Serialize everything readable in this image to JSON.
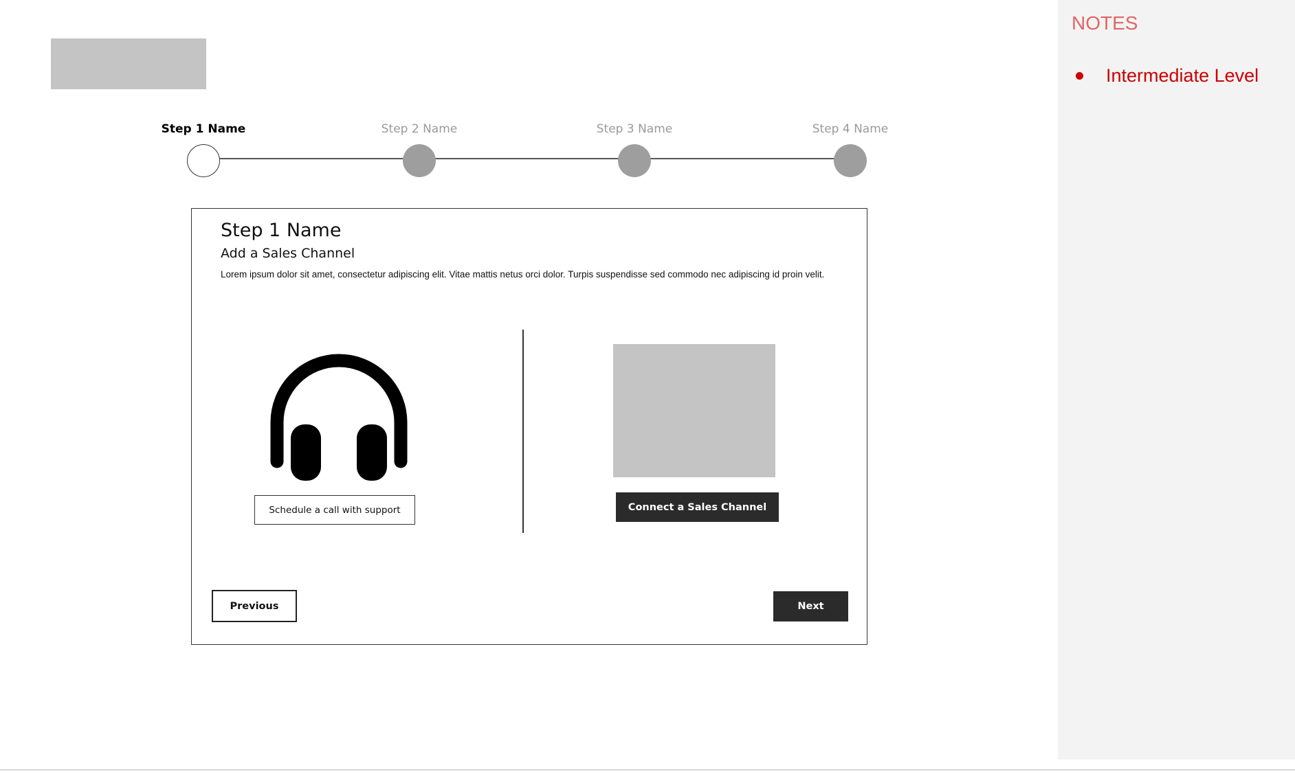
{
  "colors": {
    "notes_heading": "#e06666",
    "notes_text": "#cc0000",
    "placeholder_gray": "#c4c4c4",
    "inactive_step": "#9e9e9e",
    "dark_button": "#2b2b2b"
  },
  "stepper": {
    "current_step": 1,
    "steps": [
      {
        "label": "Step 1 Name",
        "state": "active"
      },
      {
        "label": "Step 2 Name",
        "state": "inactive"
      },
      {
        "label": "Step 3 Name",
        "state": "inactive"
      },
      {
        "label": "Step 4 Name",
        "state": "inactive"
      }
    ]
  },
  "card": {
    "title": "Step 1 Name",
    "subtitle": "Add a Sales Channel",
    "body": "Lorem ipsum dolor sit amet, consectetur adipiscing elit. Vitae mattis netus orci dolor. Turpis suspendisse sed commodo nec adipiscing id proin velit.",
    "left_option": {
      "icon": "headphones-icon",
      "button_label": "Schedule a call with support"
    },
    "right_option": {
      "button_label": "Connect a Sales Channel"
    },
    "previous_label": "Previous",
    "next_label": "Next"
  },
  "notes": {
    "title": "NOTES",
    "items": [
      "Intermediate Level"
    ]
  }
}
